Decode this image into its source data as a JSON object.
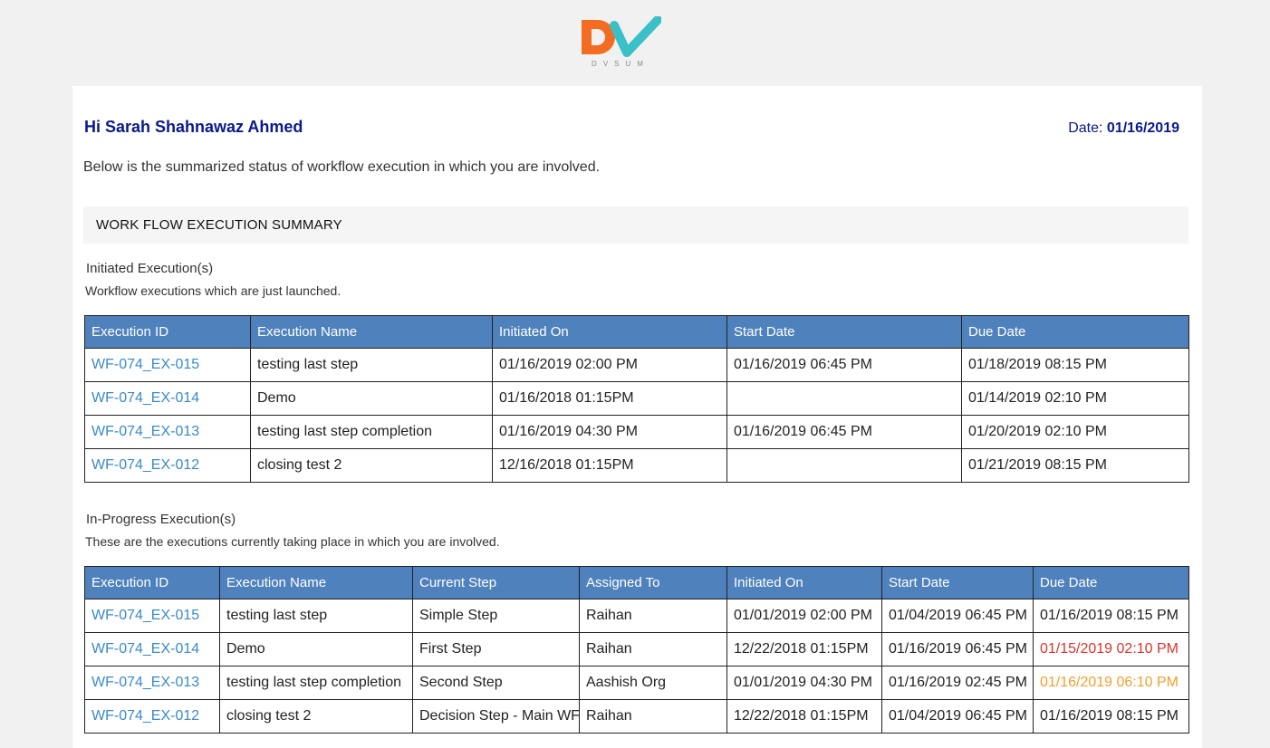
{
  "brand": {
    "logo_text": "DV",
    "logo_sub": "DVSUM",
    "colors": {
      "orange": "#f36c21",
      "teal": "#3cc0c8"
    }
  },
  "header": {
    "greeting": "Hi Sarah Shahnawaz Ahmed",
    "date_label": "Date:",
    "date_value": "01/16/2019"
  },
  "intro": "Below is the summarized status of workflow execution in which you are involved.",
  "summary_title": "WORK FLOW EXECUTION SUMMARY",
  "initiated": {
    "title": "Initiated Execution(s)",
    "description": "Workflow executions which are just launched.",
    "columns": [
      "Execution ID",
      "Execution Name",
      "Initiated On",
      "Start Date",
      "Due Date"
    ],
    "rows": [
      [
        "WF-074_EX-015",
        "testing last step",
        "01/16/2019 02:00 PM",
        "01/16/2019 06:45 PM",
        "01/18/2019 08:15 PM"
      ],
      [
        "WF-074_EX-014",
        "Demo",
        "01/16/2018 01:15PM",
        "",
        "01/14/2019 02:10 PM"
      ],
      [
        "WF-074_EX-013",
        "testing last step completion",
        "01/16/2019 04:30 PM",
        "01/16/2019 06:45 PM",
        "01/20/2019 02:10 PM"
      ],
      [
        "WF-074_EX-012",
        "closing test 2",
        "12/16/2018 01:15PM",
        "",
        "01/21/2019 08:15 PM"
      ]
    ]
  },
  "inprogress": {
    "title": "In-Progress Execution(s)",
    "description": "These are the executions currently taking place in which you are involved.",
    "columns": [
      "Execution ID",
      "Execution Name",
      "Current Step",
      "Assigned To",
      "Initiated On",
      "Start Date",
      "Due Date"
    ],
    "rows": [
      [
        "WF-074_EX-015",
        "testing last step",
        "Simple Step",
        "Raihan",
        "01/01/2019 02:00 PM",
        "01/04/2019 06:45 PM",
        "01/16/2019 08:15 PM"
      ],
      [
        "WF-074_EX-014",
        "Demo",
        "First Step",
        "Raihan",
        "12/22/2018 01:15PM",
        "01/16/2019 06:45 PM",
        "01/15/2019 02:10 PM"
      ],
      [
        "WF-074_EX-013",
        "testing last step completion",
        "Second Step",
        "Aashish Org",
        "01/01/2019 04:30 PM",
        "01/16/2019 02:45 PM",
        "01/16/2019 06:10 PM"
      ],
      [
        "WF-074_EX-012",
        "closing test 2",
        "Decision Step - Main WF",
        "Raihan",
        "12/22/2018 01:15PM",
        "01/04/2019 06:45 PM",
        "01/16/2019 08:15 PM"
      ]
    ],
    "due_status": [
      "normal",
      "overdue",
      "due-soon",
      "normal"
    ],
    "status_colors": {
      "overdue": "#d9352b",
      "due-soon": "#f0a030"
    }
  }
}
